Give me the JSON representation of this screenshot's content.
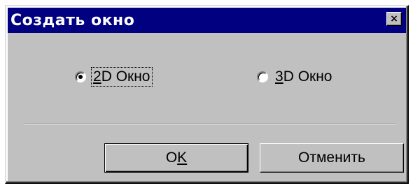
{
  "dialog": {
    "title": "Создать окно",
    "close_glyph": "×",
    "close_icon": "close-icon"
  },
  "options": [
    {
      "prefix": "",
      "mnemonic": "2",
      "rest": "D Окно",
      "selected": true
    },
    {
      "prefix": "",
      "mnemonic": "3",
      "rest": "D Окно",
      "selected": false
    }
  ],
  "buttons": {
    "ok": {
      "prefix": "O",
      "mnemonic": "K"
    },
    "cancel": {
      "label": "Отменить"
    }
  },
  "colors": {
    "titlebar": "#000080",
    "face": "#c0c0c0"
  }
}
